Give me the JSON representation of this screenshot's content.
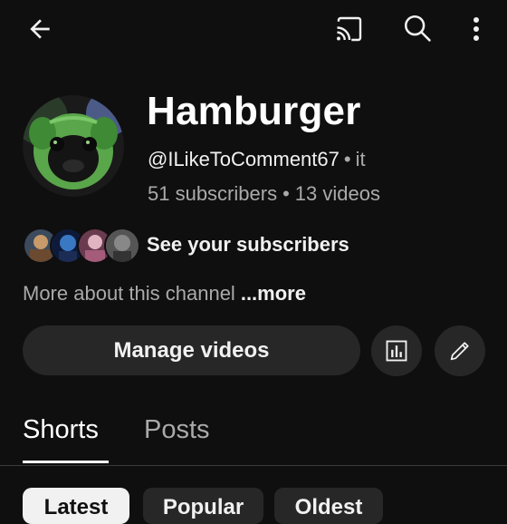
{
  "top_bar": {
    "icons": [
      "arrow-back-icon",
      "cast-icon",
      "search-icon",
      "more-vert-icon"
    ]
  },
  "channel": {
    "name": "Hamburger",
    "handle": "@ILikeToComment67",
    "handle_separator": "•",
    "handle_suffix": "it",
    "subscribers": "51 subscribers",
    "stats_separator": "•",
    "videos": "13 videos"
  },
  "subscribers_row": {
    "label": "See your subscribers"
  },
  "about": {
    "text": "More about this channel",
    "more_label": "...more"
  },
  "actions": {
    "manage_videos_label": "Manage videos",
    "icons": [
      "analytics-icon",
      "edit-pencil-icon"
    ]
  },
  "tabs": [
    {
      "label": "Shorts",
      "selected": true
    },
    {
      "label": "Posts",
      "selected": false
    }
  ],
  "chips": [
    {
      "label": "Latest",
      "selected": true
    },
    {
      "label": "Popular",
      "selected": false
    },
    {
      "label": "Oldest",
      "selected": false
    }
  ],
  "colors": {
    "background": "#0f0f0f",
    "text_primary": "#f1f1f1",
    "text_secondary": "#aaaaaa",
    "button_bg": "#272727",
    "chip_selected_bg": "#f1f1f1"
  }
}
